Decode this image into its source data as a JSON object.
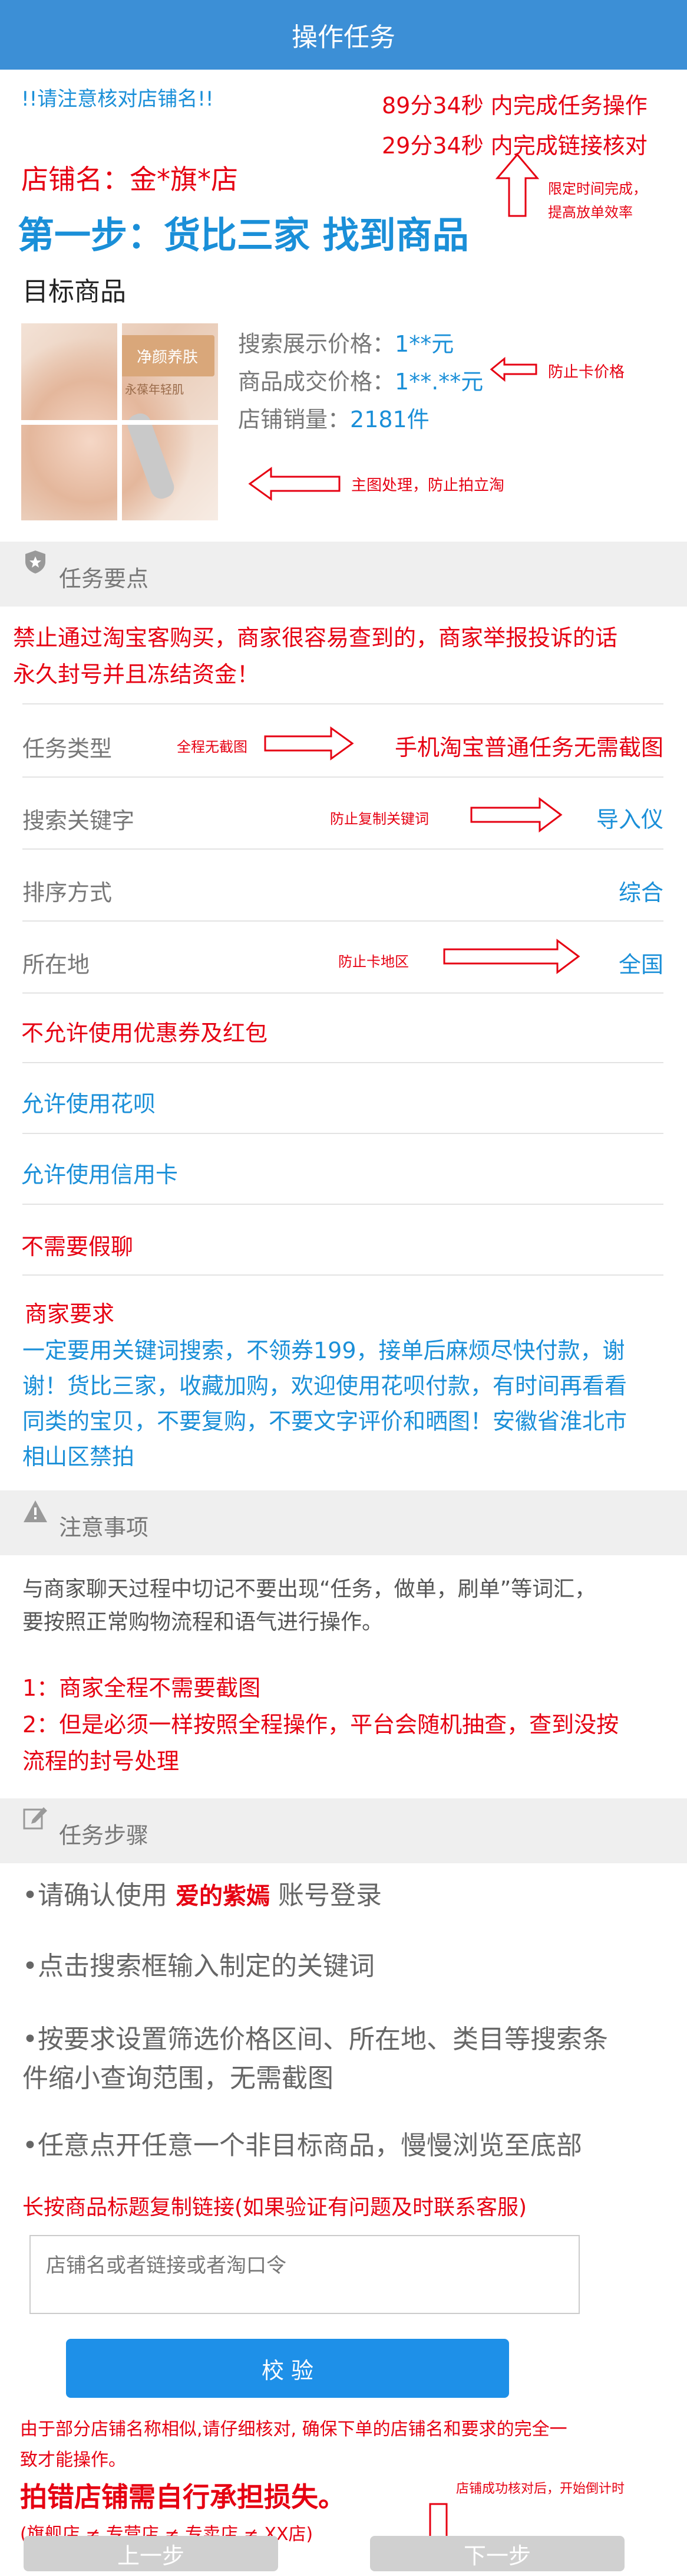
{
  "header": {
    "title": "操作任务"
  },
  "top": {
    "warning": "!!请注意核对店铺名!!",
    "timer1": "89分34秒 内完成任务操作",
    "timer2": "29分34秒 内完成链接核对",
    "timer_note_1": "限定时间完成，",
    "timer_note_2": "提高放单效率",
    "shop_name": "店铺名：金*旗*店",
    "step_title": "第一步：货比三家 找到商品"
  },
  "product": {
    "section_title": "目标商品",
    "image_text_1": "净颜养肤",
    "image_text_2": "永葆年轻肌",
    "display_price_label": "搜索展示价格：",
    "display_price": "1**元",
    "deal_price_label": "商品成交价格：",
    "deal_price": "1**.**元",
    "deal_price_note": "防止卡价格",
    "sales_label": "店铺销量：",
    "sales": "2181件",
    "image_note": "主图处理，防止拍立淘"
  },
  "task_points": {
    "title": "任务要点",
    "ban_line_1": "禁止通过淘宝客购买，商家很容易查到的，商家举报投诉的话",
    "ban_line_2": "永久封号并且冻结资金！",
    "rows": [
      {
        "label": "任务类型",
        "note": "全程无截图",
        "value": "手机淘宝普通任务无需截图"
      },
      {
        "label": "搜索关键字",
        "note": "防止复制关键词",
        "value": "导入仪"
      },
      {
        "label": "排序方式",
        "note": "",
        "value": "综合"
      },
      {
        "label": "所在地",
        "note": "防止卡地区",
        "value": "全国"
      }
    ],
    "rule_coupon": "不允许使用优惠券及红包",
    "rule_huabei": "允许使用花呗",
    "rule_credit": "允许使用信用卡",
    "rule_chat": "不需要假聊",
    "merchant_req_title": "商家要求",
    "merchant_req_1": "一定要用关键词搜索，不领券199，接单后麻烦尽快付款，谢",
    "merchant_req_2": "谢！货比三家，收藏加购，欢迎使用花呗付款，有时间再看看",
    "merchant_req_3": "同类的宝贝，不要复购，不要文字评价和晒图！安徽省淮北市",
    "merchant_req_4": "相山区禁拍"
  },
  "notes": {
    "title": "注意事项",
    "text_1": "与商家聊天过程中切记不要出现“任务，做单，刷单”等词汇，",
    "text_2": "要按照正常购物流程和语气进行操作。",
    "red_1": "1：商家全程不需要截图",
    "red_2": "2：但是必须一样按照全程操作，平台会随机抽查，查到没按",
    "red_3": "流程的封号处理"
  },
  "steps": {
    "title": "任务步骤",
    "s1_prefix": "•请确认使用 ",
    "s1_account": "爱的紫嫣",
    "s1_suffix": " 账号登录",
    "s2": "•点击搜索框输入制定的关键词",
    "s3_1": "•按要求设置筛选价格区间、所在地、类目等搜索条",
    "s3_2": "件缩小查询范围，无需截图",
    "s4": "•任意点开任意一个非目标商品，慢慢浏览至底部",
    "copy_link": "长按商品标题复制链接(如果验证有问题及时联系客服)",
    "input_placeholder": "店铺名或者链接或者淘口令",
    "verify_button": "校 验",
    "warn_1": "由于部分店铺名称相似,请仔细核对, 确保下单的店铺名和要求的完全一",
    "warn_2": "致才能操作。",
    "big_warn": "拍错店铺需自行承担损失。",
    "timer_note": "店铺成功核对后，开始倒计时",
    "shop_types": "(旗舰店 ≠ 专营店 ≠ 专卖店 ≠ XX店)",
    "prev_button": "上一步",
    "next_button": "下一步"
  },
  "colors": {
    "header": "#3c8fd6",
    "accent_red": "#e60012",
    "accent_blue": "#1a8fd8",
    "button_blue": "#1e90e8",
    "button_grey": "#d0d0d0"
  }
}
